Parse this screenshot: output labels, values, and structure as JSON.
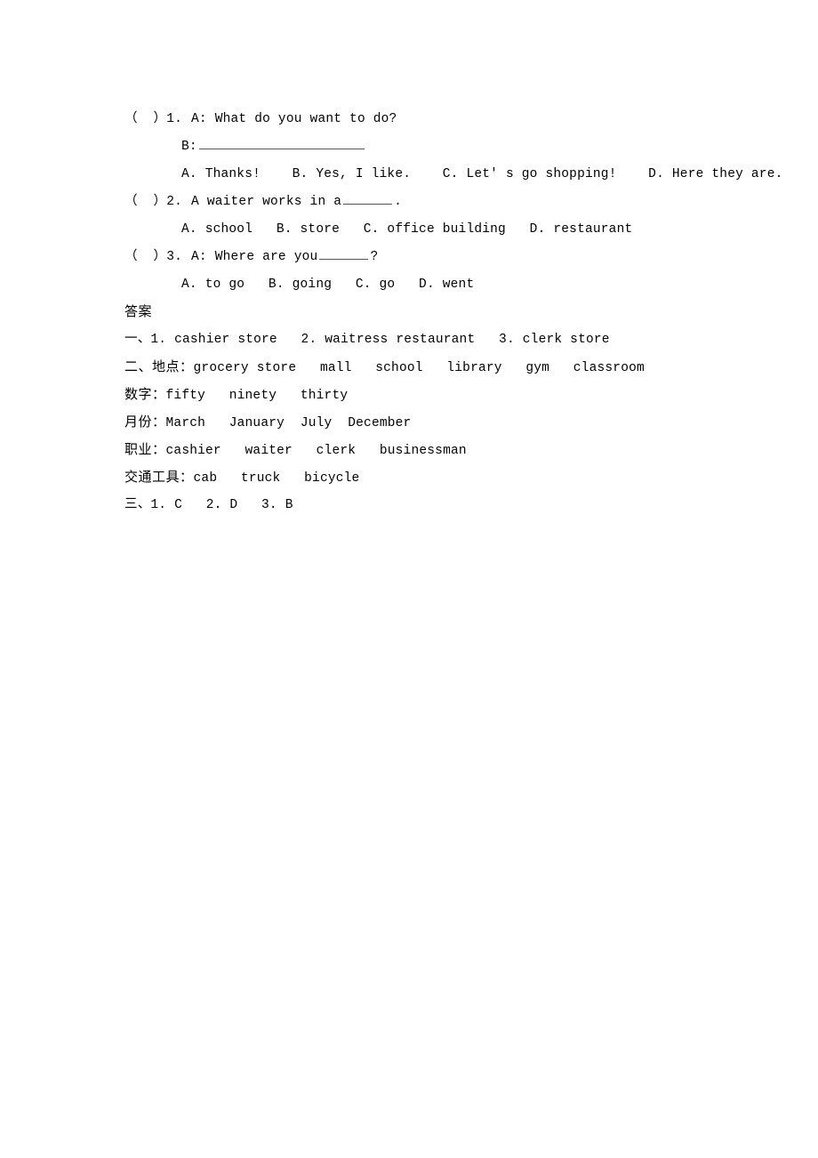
{
  "document": {
    "background_color": "#ffffff",
    "text_color": "#000000",
    "rule_color": "#555555"
  },
  "questions": [
    {
      "marker": "（  ）1.",
      "stem": "A: What do you want to do?",
      "sub_prompt": "B:",
      "options_line": "A. Thanks!    B. Yes, I like.    C. Let' s go shopping!    D. Here they are."
    },
    {
      "marker": "（  ）2.",
      "stem_before": "A waiter works in a",
      "stem_after": ".",
      "options_line": "A. school   B. store   C. office building   D. restaurant"
    },
    {
      "marker": "（  ）3.",
      "stem_before": "A: Where are you",
      "stem_after": "?",
      "options_line": "A. to go   B. going   C. go   D. went"
    }
  ],
  "answers": {
    "heading": "答案",
    "section_one": "一、1. cashier store   2. waitress restaurant   3. clerk store",
    "categories": [
      {
        "label": "二、地点：",
        "values": "grocery store   mall   school   library   gym   classroom"
      },
      {
        "label": "数字：",
        "values": "fifty   ninety   thirty"
      },
      {
        "label": "月份：",
        "values": "March   January  July  December"
      },
      {
        "label": "职业：",
        "values": "cashier   waiter   clerk   businessman"
      },
      {
        "label": "交通工具：",
        "values": "cab   truck   bicycle"
      }
    ],
    "section_three": "三、1. C   2. D   3. B"
  }
}
